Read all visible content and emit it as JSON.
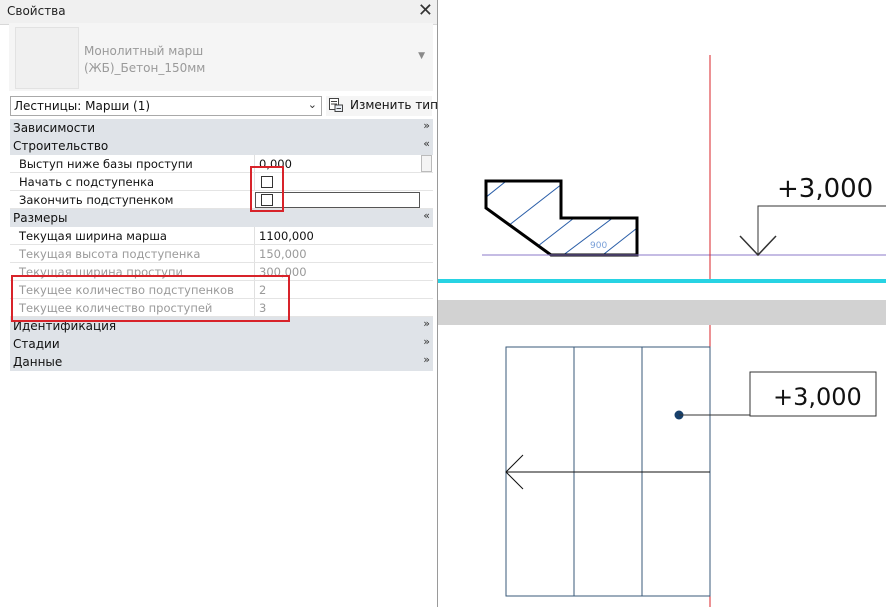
{
  "panel": {
    "title": "Свойства",
    "close_glyph": "✕",
    "type_name": "Монолитный марш\n(ЖБ)_Бетон_150мм",
    "filter_label": "Лестницы: Марши (1)",
    "edit_type_label": "Изменить тип",
    "groups": {
      "constraints": "Зависимости",
      "construction": "Строительство",
      "dimensions": "Размеры",
      "identity": "Идентификация",
      "phasing": "Стадии",
      "data": "Данные"
    },
    "properties": {
      "extend_below_base": {
        "label": "Выступ ниже базы проступи",
        "value": "0,000"
      },
      "begin_with_riser": {
        "label": "Начать с подступенка",
        "checked": false
      },
      "end_with_riser": {
        "label": "Закончить подступенком",
        "checked": false
      },
      "actual_run_width": {
        "label": "Текущая ширина марша",
        "value": "1100,000"
      },
      "actual_riser_height": {
        "label": "Текущая высота подступенка",
        "value": "150,000"
      },
      "actual_tread_depth": {
        "label": "Текущая ширина проступи",
        "value": "300,000"
      },
      "actual_risers": {
        "label": "Текущее количество подступенков",
        "value": "2"
      },
      "actual_treads": {
        "label": "Текущее количество проступей",
        "value": "3"
      }
    }
  },
  "canvas": {
    "level_top": "+3,000",
    "level_plan": "+3,000",
    "section_dim": "900"
  },
  "colors": {
    "highlight": "#d8232a",
    "level_line": "#27d3e3",
    "section_cut": "#2a5ea8",
    "view_border": "#d8232a"
  }
}
